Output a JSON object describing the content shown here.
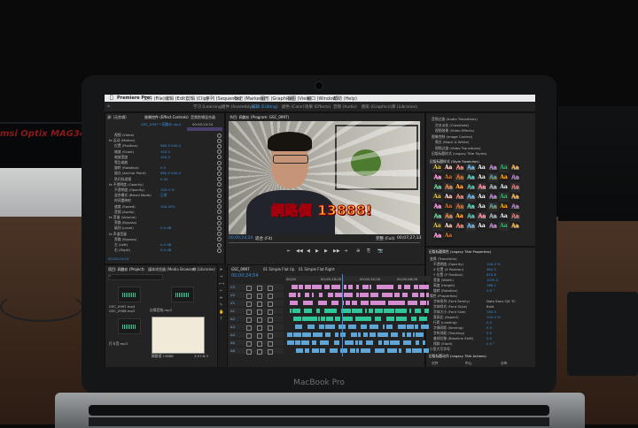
{
  "scene": {
    "background_monitor_brand": "msi",
    "background_monitor_text": "Optix MAG341C",
    "laptop_model": "MacBook Pro"
  },
  "menubar": {
    "items": [
      "Premiere Pro",
      "文件 (File)",
      "编辑 (Edit)",
      "剪辑 (Clip)",
      "序列 (Sequence)",
      "标记 (Markers)",
      "图形 (Graphics)",
      "视图 (View)",
      "窗口 (Window)",
      "帮助 (Help)"
    ]
  },
  "workspaces": {
    "items": [
      "学习 (Learning)",
      "组件 (Assembly)",
      "编辑 (Editing)",
      "颜色 (Color)",
      "效果 (Effects)",
      "音频 (Audio)",
      "图形 (Graphics)",
      "库 (Libraries)"
    ],
    "active_index": 2
  },
  "effect_controls": {
    "tabs": [
      "源: (无剪辑)",
      "效果控件 (Effect Controls)",
      "音频剪辑混合器"
    ],
    "sequence_label": "GSC_0997 * 网路价.mp4",
    "timecode": "00:00:24:24",
    "rows": [
      {
        "label": "视频 (Video)",
        "value": ""
      },
      {
        "label": "fx 运动 (Motion)",
        "value": ""
      },
      {
        "label": "位置 (Position)",
        "value": "960.0  540.0"
      },
      {
        "label": "缩放 (Scale)",
        "value": "100.0"
      },
      {
        "label": "缩放宽度",
        "value": "100.0"
      },
      {
        "label": "等比缩放",
        "value": ""
      },
      {
        "label": "旋转 (Rotation)",
        "value": "0.0"
      },
      {
        "label": "锚点 (Anchor Point)",
        "value": "960.0  540.0"
      },
      {
        "label": "防闪烁滤镜",
        "value": "0.00"
      },
      {
        "label": "fx 不透明度 (Opacity)",
        "value": ""
      },
      {
        "label": "不透明度 (Opacity)",
        "value": "100.0 %"
      },
      {
        "label": "混合模式 (Blend Mode)",
        "value": "正常"
      },
      {
        "label": "时间重映射",
        "value": ""
      },
      {
        "label": "速度 (Speed)",
        "value": "100.00%"
      },
      {
        "label": "音频 (Audio)",
        "value": ""
      },
      {
        "label": "fx 音量 (Volume)",
        "value": ""
      },
      {
        "label": "旁路 (Bypass)",
        "value": ""
      },
      {
        "label": "级别 (Level)",
        "value": "0.0 dB"
      },
      {
        "label": "fx 声道音量",
        "value": ""
      },
      {
        "label": "旁路 (Bypass)",
        "value": ""
      },
      {
        "label": "左 (Left)",
        "value": "0.0 dB"
      },
      {
        "label": "右 (Right)",
        "value": "0.0 dB"
      }
    ],
    "footer_timecode": "00:00:24:24"
  },
  "program_monitor": {
    "tab": "节目: 网路价 (Program: GSC_0997)",
    "caption": "網路價 13888!",
    "timecode_left": "00;00;24;24",
    "fit_label": "适合 (Fit)",
    "quality_label": "完整 (Full)",
    "timecode_right": "00;07;27;33",
    "transport": [
      "⇤",
      "◀◀",
      "◀",
      "▶",
      "▶",
      "▶▶",
      "⇥",
      "⊕",
      "⎘",
      "📷"
    ]
  },
  "effects_panel": {
    "tree": [
      "音频过渡 (Audio Transitions)",
      "交叉淡化 (Crossfade)",
      "视频效果 (Video Effects)",
      "图像控制 (Image Control)",
      "黑白 (Black & White)",
      "视频过渡 (Video Transitions)",
      "旧版标题样式 (Legacy Title Styles)"
    ],
    "styles_header": "旧版标题样式 (Style Swatches)",
    "swatch_text": "Aa"
  },
  "properties_panel": {
    "header": "旧版标题属性 (Legacy Title Properties)",
    "rows": [
      {
        "label": "变换 (Transform)",
        "value": ""
      },
      {
        "label": "不透明度 (Opacity)",
        "value": "100.0 %"
      },
      {
        "label": "X 位置 (X Position)",
        "value": "962.5"
      },
      {
        "label": "Y 位置 (Y Position)",
        "value": "829.6"
      },
      {
        "label": "宽度 (Width)",
        "value": "1035.0"
      },
      {
        "label": "高度 (Height)",
        "value": "186.1"
      },
      {
        "label": "旋转 (Rotation)",
        "value": "0.0 °"
      },
      {
        "label": "属性 (Properties)",
        "value": ""
      },
      {
        "label": "字体系列 (Font Family)",
        "value": "Noto Sans CJK TC"
      },
      {
        "label": "字体样式 (Font Style)",
        "value": "Bold"
      },
      {
        "label": "字体大小 (Font Size)",
        "value": "165.0"
      },
      {
        "label": "宽高比 (Aspect)",
        "value": "100.0 %"
      },
      {
        "label": "行距 (Leading)",
        "value": "0.0"
      },
      {
        "label": "字偶间距 (Kerning)",
        "value": "0.0"
      },
      {
        "label": "字符间距 (Tracking)",
        "value": "0.0"
      },
      {
        "label": "基线位移 (Baseline Shift)",
        "value": "0.0"
      },
      {
        "label": "倾斜 (Slant)",
        "value": "0.0 °"
      },
      {
        "label": "小型大写字母",
        "value": ""
      }
    ],
    "footer": [
      "旧版标题动作 (Legacy Title Actions)",
      "对齐",
      "中心",
      "分布"
    ]
  },
  "project_panel": {
    "tabs": [
      "项目: 网路价 (Project)",
      "媒体浏览器 (Media Browser)",
      "库 (Libraries)"
    ],
    "search_placeholder": "",
    "items": [
      {
        "name": "GSC_0997.mp4",
        "detail": ""
      },
      {
        "name": "GSC_0998.mp3",
        "detail": ""
      },
      {
        "name": "出場音效.mp3",
        "detail": ""
      },
      {
        "name": "打卡音.mp3",
        "detail": ""
      },
      {
        "name": "網路價 13888",
        "detail": "3:07:8:3"
      }
    ]
  },
  "timeline": {
    "tab": "GSC_0997",
    "timecode": "00;00;24;54",
    "sequence_tabs": [
      "01 Simple Flat Up",
      "01 Simple Flat Right"
    ],
    "tracks": [
      "V3",
      "V2",
      "V1",
      "A1",
      "A2",
      "A3",
      "A4",
      "A5",
      "A6"
    ],
    "ruler_labels": [
      "00;00",
      "00;00;16;00",
      "00;00;32;00",
      "00;00;48;00"
    ]
  },
  "colors": {
    "accent": "#3b8fde",
    "video_clip": "#d58dd1",
    "audio_clip": "#2fc79a",
    "caption_fill": "#ffcc33",
    "caption_stroke": "#a3000d"
  }
}
